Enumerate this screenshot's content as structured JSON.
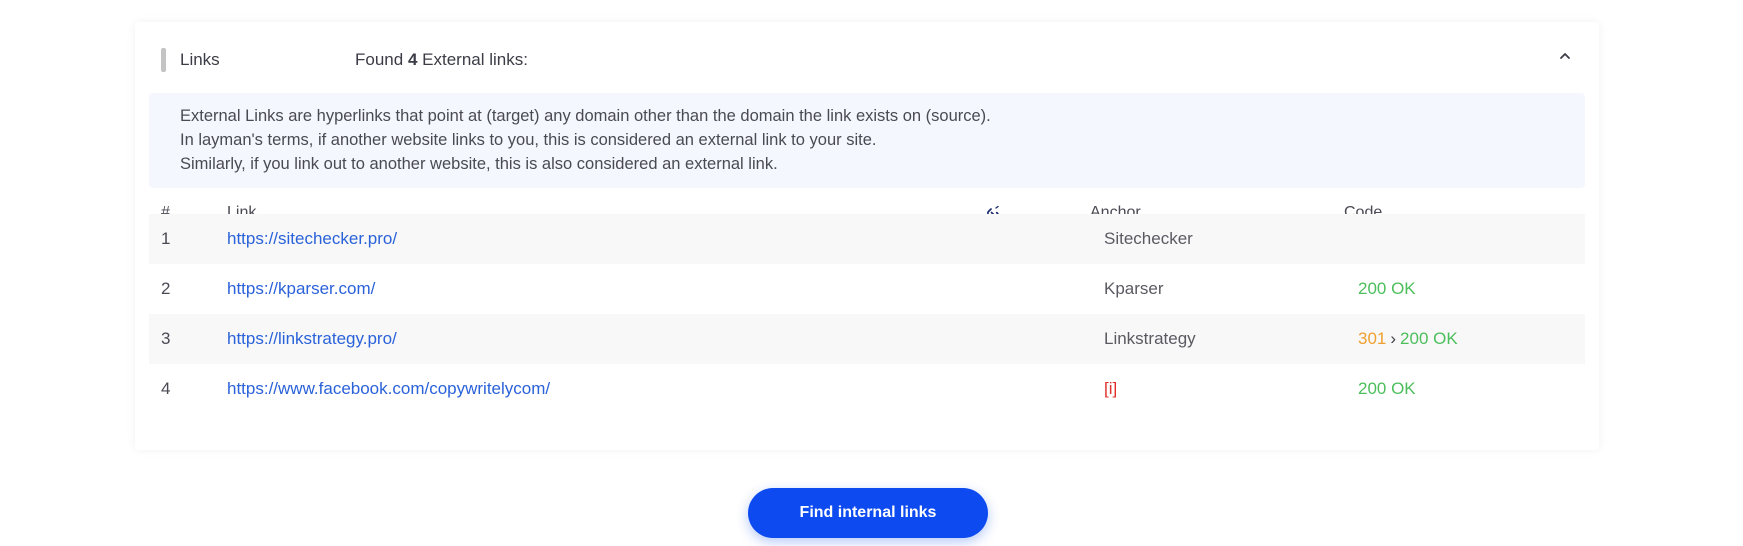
{
  "section": {
    "title": "Links",
    "found_prefix": "Found",
    "found_count": "4",
    "found_suffix": "External links:"
  },
  "info": {
    "lines": [
      "External Links are hyperlinks that point at (target) any domain other than the domain the link exists on (source).",
      "In layman's terms, if another website links to you, this is considered an external link to your site.",
      "Similarly, if you link out to another website, this is also considered an external link."
    ]
  },
  "table": {
    "headers": {
      "num": "#",
      "link": "Link",
      "nofollow_icon": "broken-link-icon",
      "anchor": "Anchor",
      "code": "Code"
    },
    "rows": [
      {
        "num": "1",
        "link": "https://sitechecker.pro/",
        "anchor": "Sitechecker",
        "redirect": "",
        "code": ""
      },
      {
        "num": "2",
        "link": "https://kparser.com/",
        "anchor": "Kparser",
        "redirect": "",
        "code": "200 OK"
      },
      {
        "num": "3",
        "link": "https://linkstrategy.pro/",
        "anchor": "Linkstrategy",
        "redirect": "301",
        "arrow": "›",
        "code": "200 OK"
      },
      {
        "num": "4",
        "link": "https://www.facebook.com/copywritelycom/",
        "anchor": "[i]",
        "redirect": "",
        "code": "200 OK"
      }
    ]
  },
  "button": {
    "label": "Find internal links"
  },
  "colors": {
    "link": "#2a62d9",
    "ok": "#4cbf5c",
    "redirect": "#f0a030",
    "error": "#e0302a",
    "primary_button": "#0d4bf0"
  }
}
